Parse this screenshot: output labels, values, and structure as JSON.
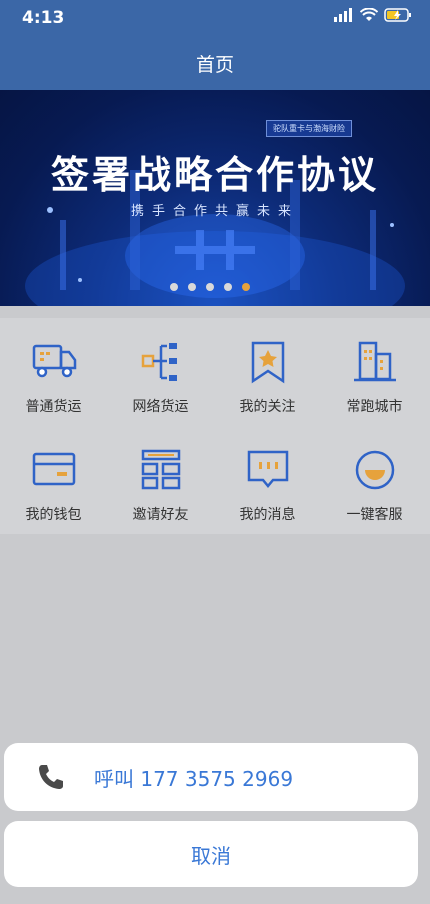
{
  "statusbar": {
    "time": "4:13"
  },
  "nav": {
    "title": "首页"
  },
  "banner": {
    "tag": "驼队重卡与渤海财险",
    "headline": "签署战略合作协议",
    "subline": "携手合作共赢未来",
    "slide_count": 5,
    "active_slide_index": 4
  },
  "menu": {
    "items": [
      {
        "label": "普通货运",
        "icon": "truck-icon"
      },
      {
        "label": "网络货运",
        "icon": "network-icon"
      },
      {
        "label": "我的关注",
        "icon": "bookmark-star-icon"
      },
      {
        "label": "常跑城市",
        "icon": "city-building-icon"
      },
      {
        "label": "我的钱包",
        "icon": "wallet-icon"
      },
      {
        "label": "邀请好友",
        "icon": "invite-grid-icon"
      },
      {
        "label": "我的消息",
        "icon": "message-icon"
      },
      {
        "label": "一键客服",
        "icon": "customer-service-icon"
      }
    ]
  },
  "action_sheet": {
    "call_label": "呼叫 177 3575 2969",
    "cancel_label": "取消"
  },
  "colors": {
    "header": "#3b67a7",
    "icon_blue": "#2f63c7",
    "icon_orange": "#e6a23c",
    "action_text": "#3a78d6"
  }
}
